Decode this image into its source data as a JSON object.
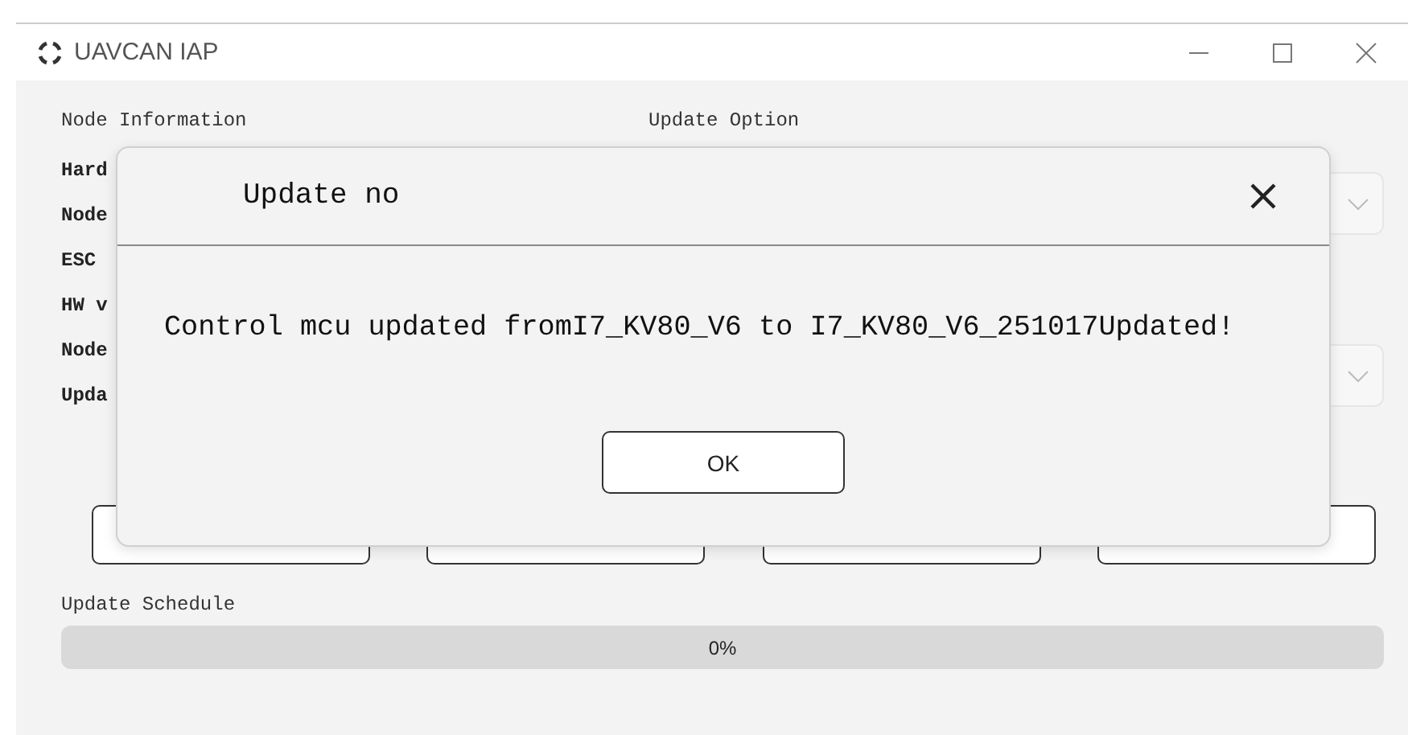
{
  "window": {
    "title": "UAVCAN IAP"
  },
  "node_information": {
    "heading": "Node Information",
    "labels": [
      "Hard",
      "Node",
      "ESC",
      "HW v",
      "Node",
      "Upda"
    ]
  },
  "update_option": {
    "heading": "Update Option"
  },
  "update_schedule": {
    "label": "Update Schedule",
    "level": 0,
    "reading": "0%"
  },
  "dialog": {
    "title": "Update no",
    "message": "Control mcu updated fromI7_KV80_V6 to I7_KV80_V6_251017Updated!",
    "ok_button": "OK"
  }
}
